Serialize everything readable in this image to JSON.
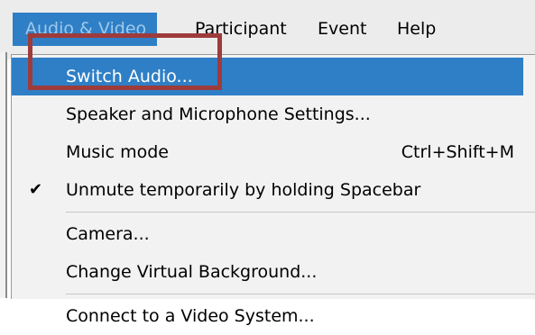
{
  "menubar": {
    "items": [
      {
        "label": "Audio & Video"
      },
      {
        "label": "Participant"
      },
      {
        "label": "Event"
      },
      {
        "label": "Help"
      }
    ]
  },
  "dropdown": {
    "items": [
      {
        "label": "Switch Audio...",
        "highlighted": true
      },
      {
        "label": "Speaker and Microphone Settings..."
      },
      {
        "label": "Music mode",
        "shortcut": "Ctrl+Shift+M"
      },
      {
        "label": "Unmute temporarily by holding Spacebar",
        "checked": true,
        "check_glyph": "✔"
      },
      {
        "label": "Camera..."
      },
      {
        "label": "Change Virtual Background..."
      },
      {
        "label": "Connect to a Video System..."
      }
    ]
  },
  "colors": {
    "highlight": "#2f7fc6",
    "annotation_box": "#9e3b3b"
  }
}
